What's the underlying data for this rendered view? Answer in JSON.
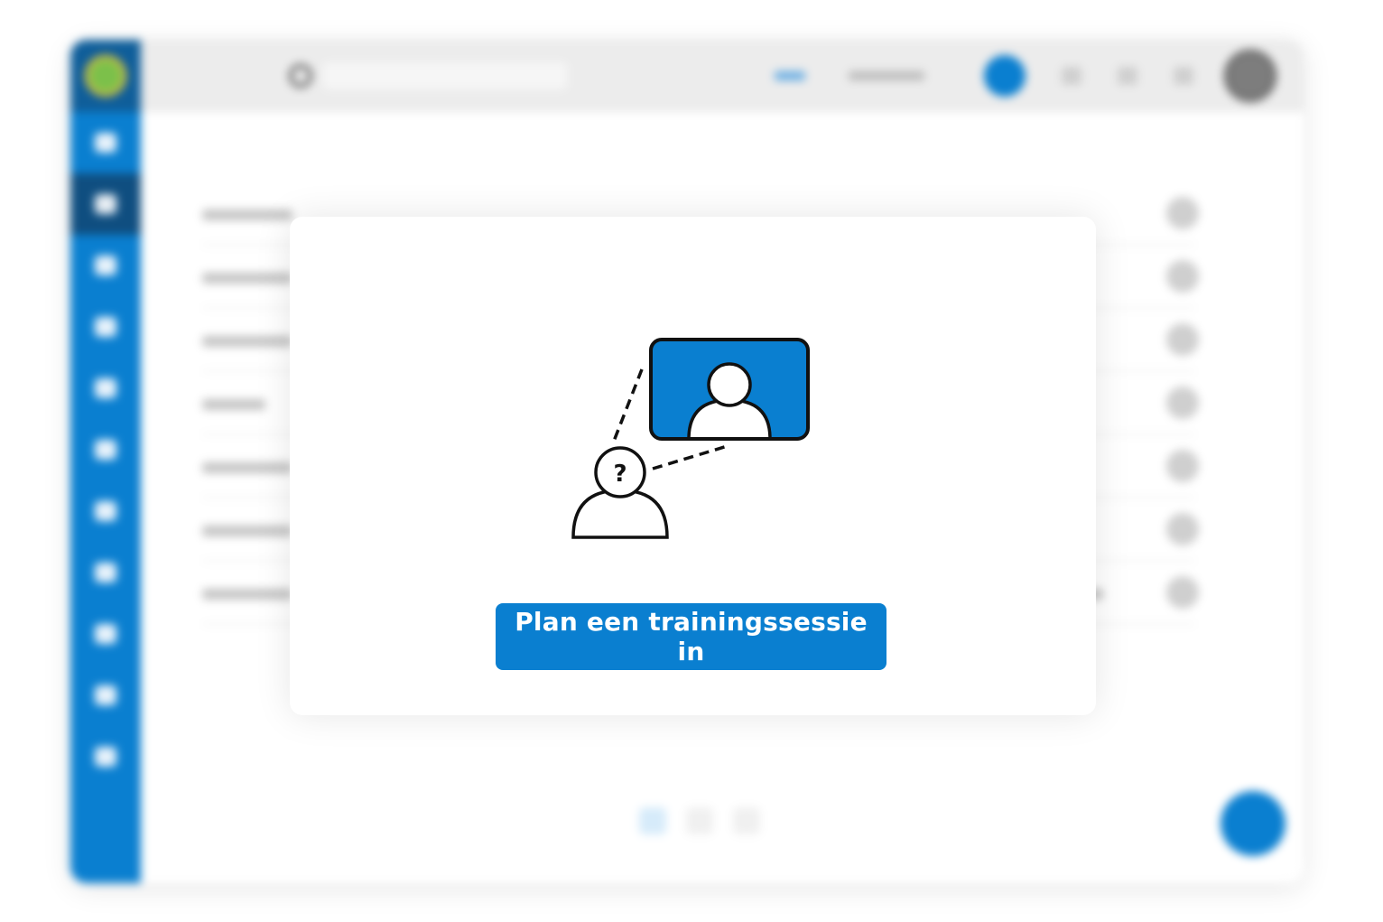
{
  "colors": {
    "primary": "#0a7fd0",
    "sidebar_active": "#0f4e80",
    "modal_bg": "#ffffff"
  },
  "modal": {
    "illustration": {
      "icon": "person-question-video-call-icon",
      "question_mark": "?"
    },
    "cta_label": "Plan een trainingssessie in"
  }
}
